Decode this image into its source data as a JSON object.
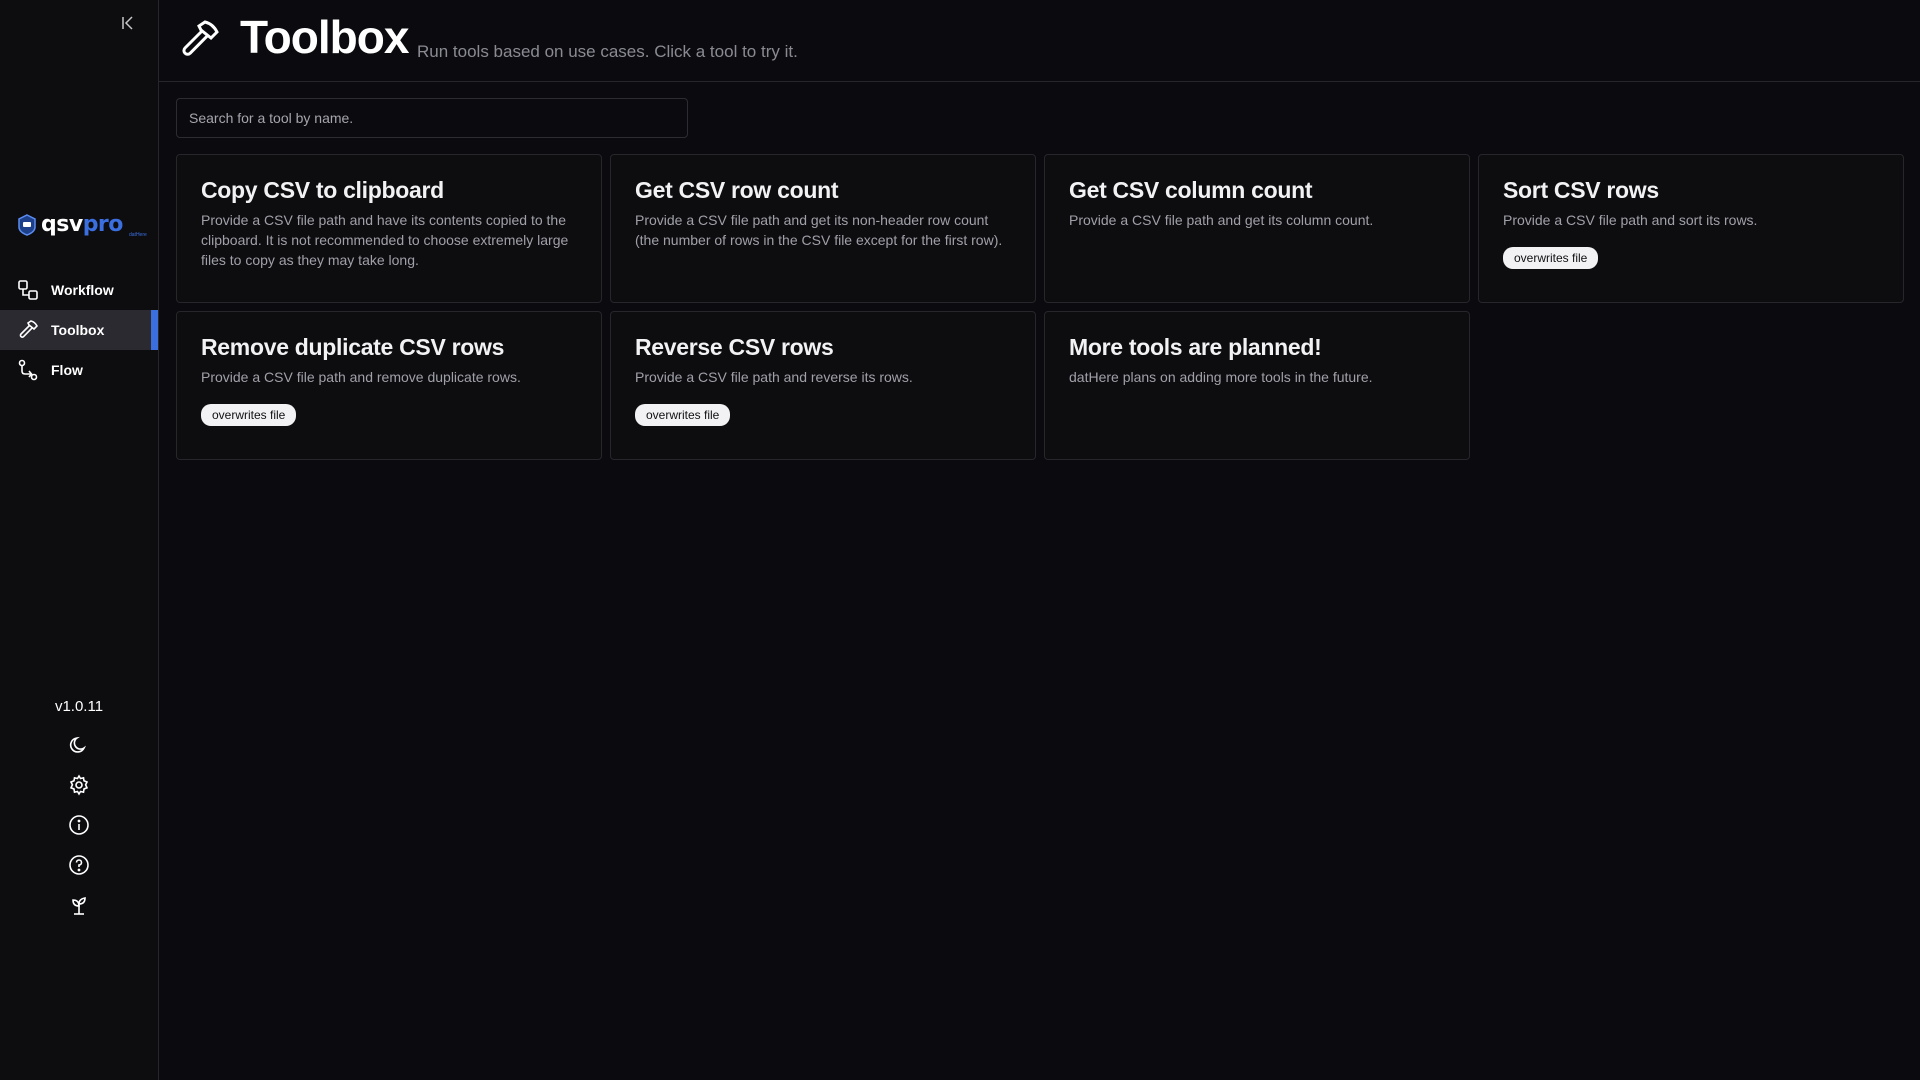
{
  "sidebar": {
    "logo": {
      "main": "qsv",
      "accent": "pro",
      "sub": "datHere"
    },
    "nav": [
      {
        "label": "Workflow",
        "icon": "workflow-icon"
      },
      {
        "label": "Toolbox",
        "icon": "hammer-icon",
        "active": true
      },
      {
        "label": "Flow",
        "icon": "flow-icon"
      }
    ],
    "version": "v1.0.11",
    "bottom_icons": [
      "moon-icon",
      "gear-icon",
      "info-icon",
      "help-icon",
      "sprout-icon"
    ]
  },
  "header": {
    "title": "Toolbox",
    "subtitle": "Run tools based on use cases. Click a tool to try it."
  },
  "search": {
    "placeholder": "Search for a tool by name."
  },
  "tools": [
    {
      "title": "Copy CSV to clipboard",
      "description": "Provide a CSV file path and have its contents copied to the clipboard. It is not recommended to choose extremely large files to copy as they may take long.",
      "badge": ""
    },
    {
      "title": "Get CSV row count",
      "description": "Provide a CSV file path and get its non-header row count (the number of rows in the CSV file except for the first row).",
      "badge": ""
    },
    {
      "title": "Get CSV column count",
      "description": "Provide a CSV file path and get its column count.",
      "badge": ""
    },
    {
      "title": "Sort CSV rows",
      "description": "Provide a CSV file path and sort its rows.",
      "badge": "overwrites file"
    },
    {
      "title": "Remove duplicate CSV rows",
      "description": "Provide a CSV file path and remove duplicate rows.",
      "badge": "overwrites file"
    },
    {
      "title": "Reverse CSV rows",
      "description": "Provide a CSV file path and reverse its rows.",
      "badge": "overwrites file"
    },
    {
      "title": "More tools are planned!",
      "description": "datHere plans on adding more tools in the future.",
      "badge": ""
    }
  ],
  "colors": {
    "accent": "#3b6fe0",
    "background": "#0b0b0f",
    "card_border": "#26262b"
  }
}
